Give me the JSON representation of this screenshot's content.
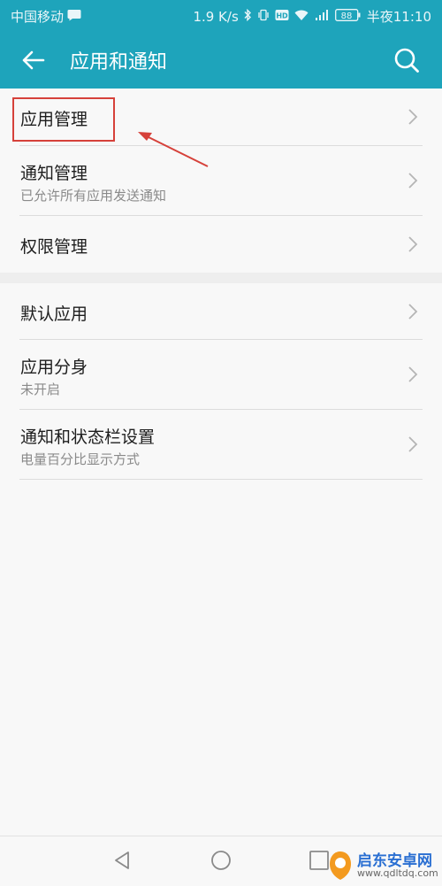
{
  "status_bar": {
    "carrier": "中国移动",
    "speed": "1.9 K/s",
    "battery": "88",
    "time": "半夜11:10"
  },
  "app_bar": {
    "title": "应用和通知",
    "back_icon": "back-arrow-icon",
    "search_icon": "search-icon"
  },
  "settings": {
    "group1": [
      {
        "label": "应用管理",
        "subtitle": ""
      },
      {
        "label": "通知管理",
        "subtitle": "已允许所有应用发送通知"
      },
      {
        "label": "权限管理",
        "subtitle": ""
      }
    ],
    "group2": [
      {
        "label": "默认应用",
        "subtitle": ""
      },
      {
        "label": "应用分身",
        "subtitle": "未开启"
      },
      {
        "label": "通知和状态栏设置",
        "subtitle": "电量百分比显示方式"
      }
    ]
  },
  "annotation": {
    "highlight_color": "#d6413a"
  },
  "watermark": {
    "name": "启东安卓网",
    "url": "www.qdltdq.com"
  },
  "colors": {
    "accent": "#1ea4bb"
  }
}
